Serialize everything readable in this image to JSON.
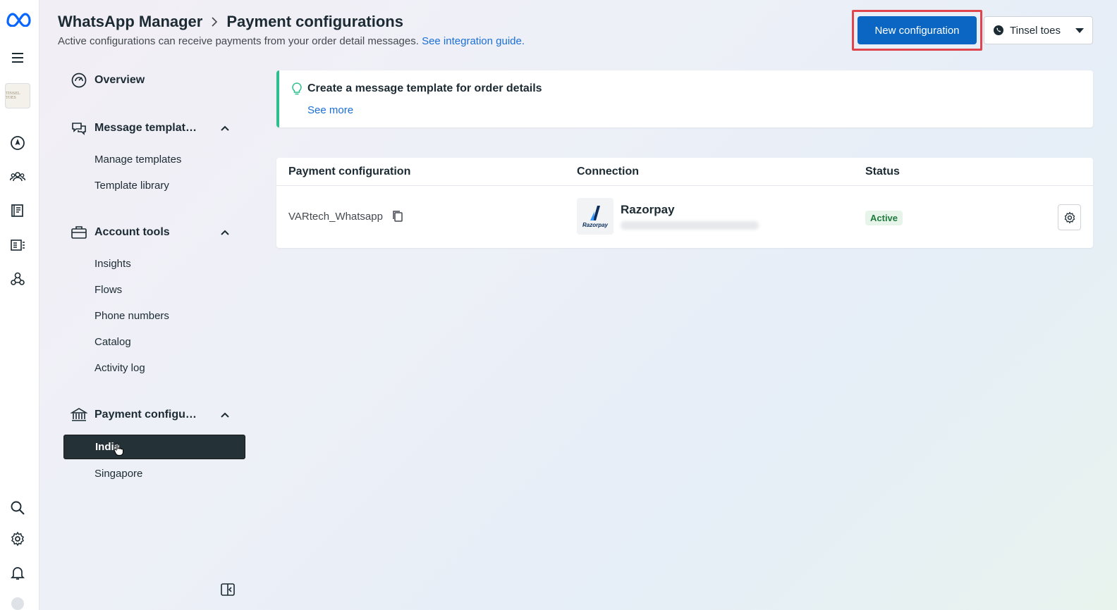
{
  "header": {
    "app_name": "WhatsApp Manager",
    "page_title": "Payment configurations",
    "subtitle": "Active configurations can receive payments from your order detail messages.",
    "guide_link": "See integration guide."
  },
  "toolbar": {
    "new_config_label": "New configuration",
    "account_label": "Tinsel toes"
  },
  "brand_thumb_text": "TINSEL TOES",
  "nav": {
    "overview": "Overview",
    "message_templates": {
      "label": "Message templat…",
      "items": [
        "Manage templates",
        "Template library"
      ]
    },
    "account_tools": {
      "label": "Account tools",
      "items": [
        "Insights",
        "Flows",
        "Phone numbers",
        "Catalog",
        "Activity log"
      ]
    },
    "payment_config": {
      "label": "Payment configu…",
      "items": [
        "India",
        "Singapore"
      ],
      "active_index": 0
    }
  },
  "tip": {
    "title": "Create a message template for order details",
    "link": "See more"
  },
  "table": {
    "columns": [
      "Payment configuration",
      "Connection",
      "Status"
    ],
    "rows": [
      {
        "name": "VARtech_Whatsapp",
        "connection": "Razorpay",
        "logo_text": "Razorpay",
        "status": "Active"
      }
    ]
  },
  "colors": {
    "primary_button": "#0a66c2",
    "highlight_border": "#e0454e",
    "tip_accent": "#2fbf8f",
    "active_badge_bg": "#e6f4ea",
    "active_badge_text": "#1f7a3d",
    "nav_active_bg": "#243238",
    "link": "#1a6ed8"
  }
}
